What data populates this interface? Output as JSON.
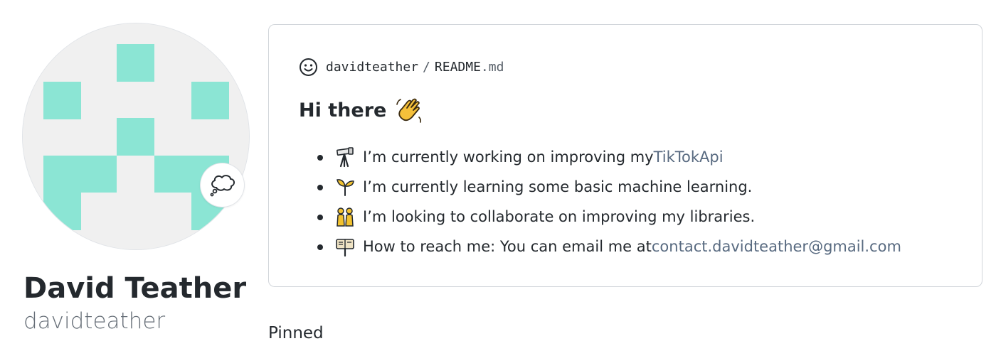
{
  "profile": {
    "name": "David Teather",
    "username": "davidteather",
    "avatar": {
      "icon": "identicon-avatar",
      "fg_color": "#8be5d4",
      "bg_color": "#f0f0f0"
    },
    "status_icon": "thought-balloon-icon"
  },
  "readme": {
    "header": {
      "icon": "smiley-icon",
      "owner": "davidteather",
      "separator": "/",
      "file_name": "README",
      "file_ext": ".md"
    },
    "heading": "Hi there",
    "heading_icon": "waving-hand-icon",
    "items": [
      {
        "icon": "telescope-icon",
        "text": "I’m currently working on improving my ",
        "link": "TikTokApi"
      },
      {
        "icon": "seedling-icon",
        "text": "I’m currently learning some basic machine learning."
      },
      {
        "icon": "people-icon",
        "text": "I’m looking to collaborate on improving my libraries."
      },
      {
        "icon": "mailbox-icon",
        "text": "How to reach me: You can email me at ",
        "link": "contact.davidteather@gmail.com"
      }
    ],
    "link_color": "#586a80"
  },
  "pinned": {
    "label": "Pinned"
  }
}
